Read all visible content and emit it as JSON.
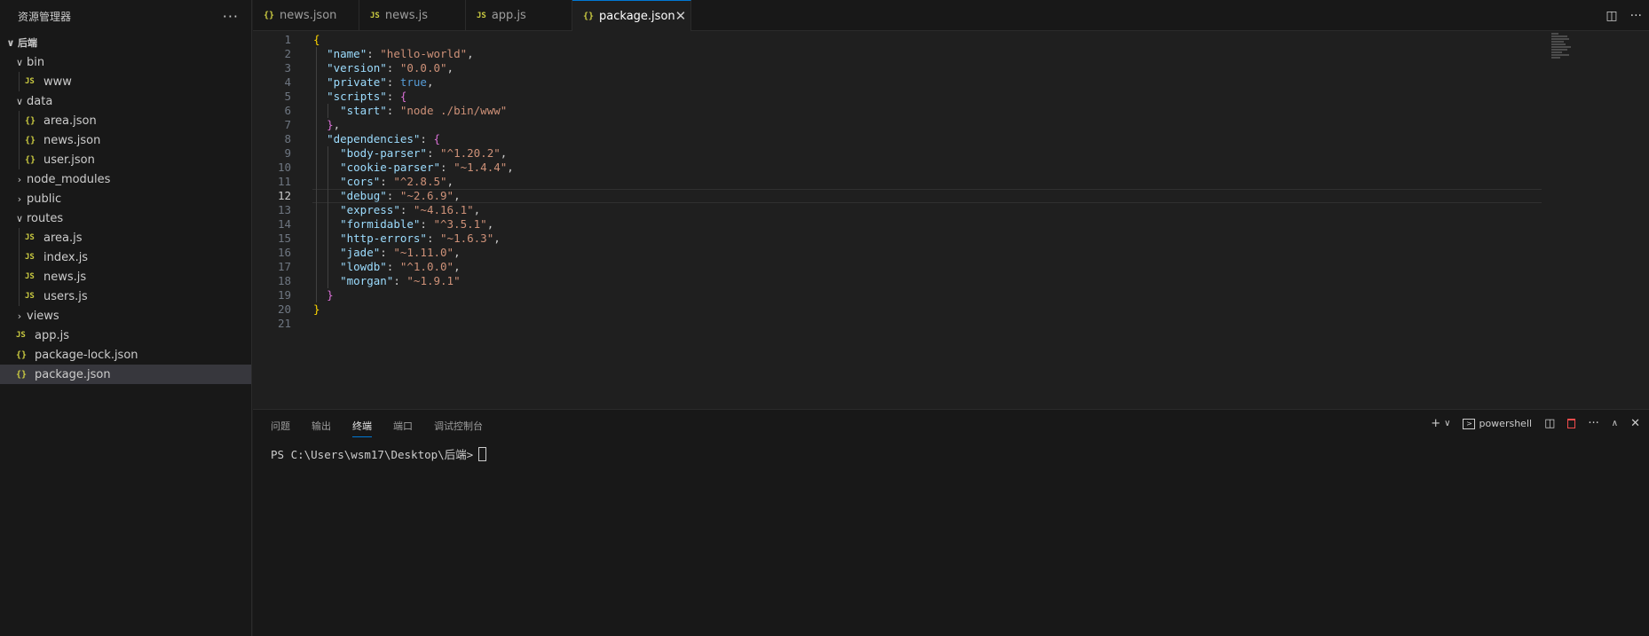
{
  "explorer": {
    "title": "资源管理器",
    "more": "···",
    "tree": [
      {
        "label": "后端",
        "depth": 0,
        "type": "folder",
        "open": true,
        "root": true
      },
      {
        "label": "bin",
        "depth": 1,
        "type": "folder",
        "open": true
      },
      {
        "label": "www",
        "depth": 2,
        "type": "js"
      },
      {
        "label": "data",
        "depth": 1,
        "type": "folder",
        "open": true
      },
      {
        "label": "area.json",
        "depth": 2,
        "type": "json"
      },
      {
        "label": "news.json",
        "depth": 2,
        "type": "json"
      },
      {
        "label": "user.json",
        "depth": 2,
        "type": "json"
      },
      {
        "label": "node_modules",
        "depth": 1,
        "type": "folder",
        "open": false
      },
      {
        "label": "public",
        "depth": 1,
        "type": "folder",
        "open": false
      },
      {
        "label": "routes",
        "depth": 1,
        "type": "folder",
        "open": true
      },
      {
        "label": "area.js",
        "depth": 2,
        "type": "js"
      },
      {
        "label": "index.js",
        "depth": 2,
        "type": "js"
      },
      {
        "label": "news.js",
        "depth": 2,
        "type": "js"
      },
      {
        "label": "users.js",
        "depth": 2,
        "type": "js"
      },
      {
        "label": "views",
        "depth": 1,
        "type": "folder",
        "open": false
      },
      {
        "label": "app.js",
        "depth": 1,
        "type": "js"
      },
      {
        "label": "package-lock.json",
        "depth": 1,
        "type": "json"
      },
      {
        "label": "package.json",
        "depth": 1,
        "type": "json",
        "selected": true
      }
    ]
  },
  "icons": {
    "js": "JS",
    "json": "{}",
    "chevron_open": "∨",
    "chevron_closed": "›"
  },
  "tabs": [
    {
      "label": "news.json",
      "type": "json"
    },
    {
      "label": "news.js",
      "type": "js"
    },
    {
      "label": "app.js",
      "type": "js"
    },
    {
      "label": "package.json",
      "type": "json",
      "active": true,
      "close": "✕"
    }
  ],
  "tab_actions": {
    "split": "◫",
    "more": "···"
  },
  "editor": {
    "current_line": 12,
    "lines": [
      [
        [
          "br1",
          "{"
        ]
      ],
      [
        [
          "p",
          "  "
        ],
        [
          "k",
          "\"name\""
        ],
        [
          "p",
          ": "
        ],
        [
          "s",
          "\"hello-world\""
        ],
        [
          "p",
          ","
        ]
      ],
      [
        [
          "p",
          "  "
        ],
        [
          "k",
          "\"version\""
        ],
        [
          "p",
          ": "
        ],
        [
          "s",
          "\"0.0.0\""
        ],
        [
          "p",
          ","
        ]
      ],
      [
        [
          "p",
          "  "
        ],
        [
          "k",
          "\"private\""
        ],
        [
          "p",
          ": "
        ],
        [
          "b",
          "true"
        ],
        [
          "p",
          ","
        ]
      ],
      [
        [
          "p",
          "  "
        ],
        [
          "k",
          "\"scripts\""
        ],
        [
          "p",
          ": "
        ],
        [
          "br2",
          "{"
        ]
      ],
      [
        [
          "p",
          "    "
        ],
        [
          "k",
          "\"start\""
        ],
        [
          "p",
          ": "
        ],
        [
          "s",
          "\"node ./bin/www\""
        ]
      ],
      [
        [
          "p",
          "  "
        ],
        [
          "br2",
          "}"
        ],
        [
          "p",
          ","
        ]
      ],
      [
        [
          "p",
          "  "
        ],
        [
          "k",
          "\"dependencies\""
        ],
        [
          "p",
          ": "
        ],
        [
          "br2",
          "{"
        ]
      ],
      [
        [
          "p",
          "    "
        ],
        [
          "k",
          "\"body-parser\""
        ],
        [
          "p",
          ": "
        ],
        [
          "s",
          "\"^1.20.2\""
        ],
        [
          "p",
          ","
        ]
      ],
      [
        [
          "p",
          "    "
        ],
        [
          "k",
          "\"cookie-parser\""
        ],
        [
          "p",
          ": "
        ],
        [
          "s",
          "\"~1.4.4\""
        ],
        [
          "p",
          ","
        ]
      ],
      [
        [
          "p",
          "    "
        ],
        [
          "k",
          "\"cors\""
        ],
        [
          "p",
          ": "
        ],
        [
          "s",
          "\"^2.8.5\""
        ],
        [
          "p",
          ","
        ]
      ],
      [
        [
          "p",
          "    "
        ],
        [
          "k",
          "\"debug\""
        ],
        [
          "p",
          ": "
        ],
        [
          "s",
          "\"~2.6.9\""
        ],
        [
          "p",
          ","
        ]
      ],
      [
        [
          "p",
          "    "
        ],
        [
          "k",
          "\"express\""
        ],
        [
          "p",
          ": "
        ],
        [
          "s",
          "\"~4.16.1\""
        ],
        [
          "p",
          ","
        ]
      ],
      [
        [
          "p",
          "    "
        ],
        [
          "k",
          "\"formidable\""
        ],
        [
          "p",
          ": "
        ],
        [
          "s",
          "\"^3.5.1\""
        ],
        [
          "p",
          ","
        ]
      ],
      [
        [
          "p",
          "    "
        ],
        [
          "k",
          "\"http-errors\""
        ],
        [
          "p",
          ": "
        ],
        [
          "s",
          "\"~1.6.3\""
        ],
        [
          "p",
          ","
        ]
      ],
      [
        [
          "p",
          "    "
        ],
        [
          "k",
          "\"jade\""
        ],
        [
          "p",
          ": "
        ],
        [
          "s",
          "\"~1.11.0\""
        ],
        [
          "p",
          ","
        ]
      ],
      [
        [
          "p",
          "    "
        ],
        [
          "k",
          "\"lowdb\""
        ],
        [
          "p",
          ": "
        ],
        [
          "s",
          "\"^1.0.0\""
        ],
        [
          "p",
          ","
        ]
      ],
      [
        [
          "p",
          "    "
        ],
        [
          "k",
          "\"morgan\""
        ],
        [
          "p",
          ": "
        ],
        [
          "s",
          "\"~1.9.1\""
        ]
      ],
      [
        [
          "p",
          "  "
        ],
        [
          "br2",
          "}"
        ]
      ],
      [
        [
          "br1",
          "}"
        ]
      ],
      []
    ]
  },
  "panel": {
    "tabs": [
      {
        "label": "问题"
      },
      {
        "label": "输出"
      },
      {
        "label": "终端",
        "active": true
      },
      {
        "label": "端口"
      },
      {
        "label": "调试控制台"
      }
    ],
    "actions": {
      "add": "+",
      "dropdown": "∨",
      "terminal_name": "powershell",
      "split": "◫",
      "trash": "🗑",
      "more": "···",
      "maximize": "∧",
      "close": "✕"
    },
    "terminal_prompt": "PS C:\\Users\\wsm17\\Desktop\\后端>"
  }
}
